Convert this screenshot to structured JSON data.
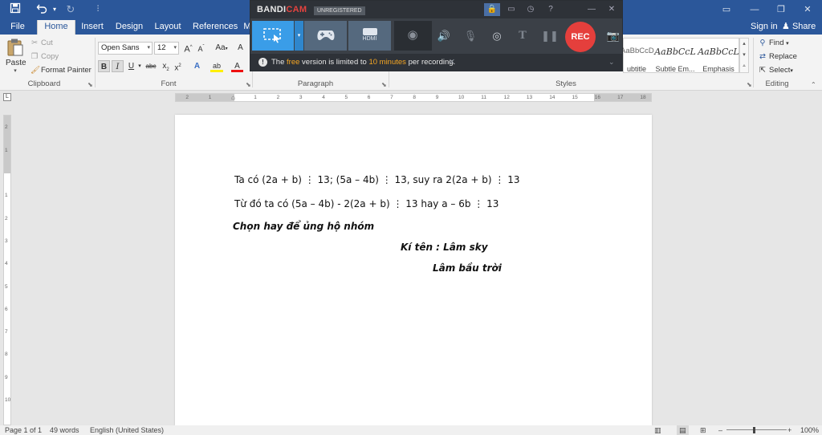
{
  "quick_access": {
    "save_icon": "save-icon",
    "undo_icon": "undo-icon",
    "redo_icon": "redo-icon",
    "customize_icon": "customize-qat-icon"
  },
  "window_controls": [
    "ribbon-options-icon",
    "minimize-icon",
    "restore-icon",
    "close-icon"
  ],
  "tabs": [
    "File",
    "Home",
    "Insert",
    "Design",
    "Layout",
    "References",
    "M"
  ],
  "active_tab": "Home",
  "account": {
    "sign_in": "Sign in",
    "share": "Share"
  },
  "ribbon": {
    "clipboard": {
      "paste": "Paste",
      "cut": "Cut",
      "copy": "Copy",
      "format_painter": "Format Painter",
      "label": "Clipboard"
    },
    "font": {
      "font_name": "Open Sans",
      "font_size": "12",
      "grow": "A",
      "shrink": "A",
      "change_case": "Aa",
      "clear_formatting": "A",
      "bold": "B",
      "italic": "I",
      "underline": "U",
      "strikethrough": "abc",
      "subscript": "x",
      "superscript": "x",
      "text_effects": "A",
      "highlight": "ab",
      "font_color": "A",
      "label": "Font"
    },
    "paragraph": {
      "label": "Paragraph"
    },
    "styles": {
      "items": [
        {
          "preview": "AaBbCcD",
          "name": "ubtitle"
        },
        {
          "preview": "AaBbCcL",
          "name": "Subtle Em..."
        },
        {
          "preview": "AaBbCcL",
          "name": "Emphasis"
        }
      ],
      "label": "Styles"
    },
    "editing": {
      "find": "Find",
      "replace": "Replace",
      "select": "Select",
      "label": "Editing"
    }
  },
  "ruler": {
    "tab_selector": "L",
    "labels": [
      "2",
      "1",
      "1",
      "2",
      "3",
      "4",
      "5",
      "6",
      "7",
      "8",
      "9",
      "10",
      "11",
      "12",
      "13",
      "14",
      "15",
      "16",
      "17",
      "18"
    ],
    "vertical_labels": [
      "2",
      "1",
      "1",
      "2",
      "3",
      "4",
      "5",
      "6",
      "7",
      "8",
      "9",
      "10",
      "11",
      "12",
      "13"
    ]
  },
  "document": {
    "lines": [
      "Ta có (2a + b) ⋮ 13; (5a – 4b) ⋮ 13, suy ra 2(2a + b) ⋮ 13",
      "Từ đó ta có (5a – 4b) - 2(2a + b) ⋮ 13 hay a – 6b ⋮ 13",
      "Chọn hay để ủng hộ nhóm",
      "Kí tên : Lâm sky",
      "Lâm bầu trời"
    ]
  },
  "status_bar": {
    "page": "Page 1 of 1",
    "words": "49 words",
    "language": "English (United States)",
    "zoom_minus": "–",
    "zoom_plus": "+",
    "zoom": "100%",
    "view_icons": [
      "read-mode-icon",
      "print-layout-icon",
      "web-layout-icon"
    ]
  },
  "bandicam": {
    "logo_bandi": "BANDI",
    "logo_cam": "CAM",
    "badge": "UNREGISTERED",
    "title_icons": [
      "lock-icon",
      "folder-icon",
      "clock-icon",
      "help-icon",
      "minimize-icon",
      "close-icon"
    ],
    "mode_hdmi": "HDMI",
    "rec": "REC",
    "notice_pre": "The ",
    "notice_free": "free",
    "notice_mid": " version is limited to ",
    "notice_minutes": "10 minutes",
    "notice_post": " per recording.",
    "colors": {
      "accent": "#3a9de8",
      "rec": "#e53f3c",
      "highlight": "#f5a623"
    }
  },
  "colors": {
    "word_blue": "#2b579a"
  }
}
